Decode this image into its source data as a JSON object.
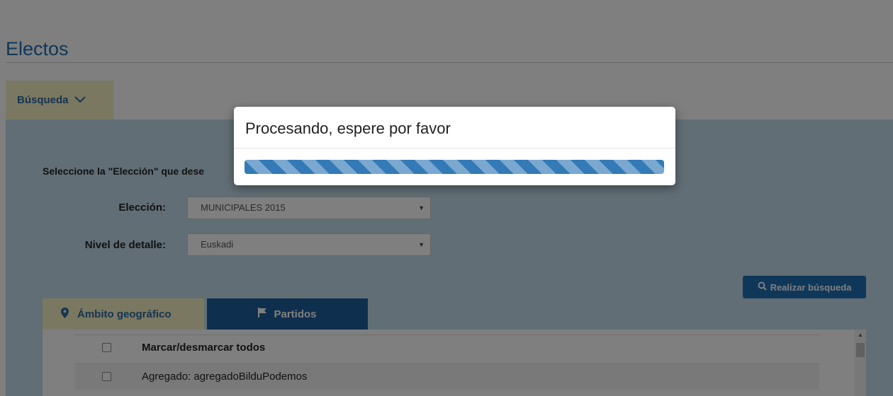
{
  "page": {
    "title": "Electos"
  },
  "search_tab": {
    "label": "Búsqueda"
  },
  "form": {
    "instruction": "Seleccione la \"Elección\" que dese",
    "eleccion_label": "Elección:",
    "eleccion_value": "MUNICIPALES 2015",
    "nivel_label": "Nivel de detalle:",
    "nivel_value": "Euskadi"
  },
  "search_button": {
    "label": "Realizar búsqueda"
  },
  "tabs": {
    "geo": "Ámbito geográfico",
    "partidos": "Partidos"
  },
  "list": {
    "header": "Marcar/desmarcar todos",
    "items": [
      "Agregado: agregadoBilduPodemos"
    ]
  },
  "modal": {
    "title": "Procesando, espere por favor",
    "progress": 1.0
  },
  "colors": {
    "brand_blue": "#1f6fb2",
    "tab_yellow": "#f6f0c4",
    "panel_blue": "#c2dceb"
  }
}
